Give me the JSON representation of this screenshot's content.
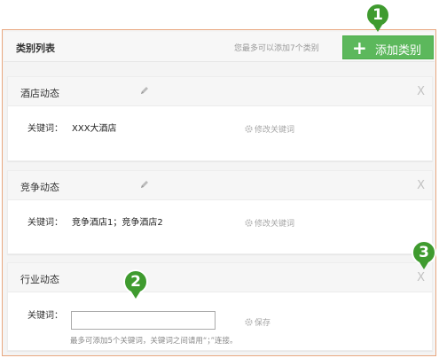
{
  "header": {
    "title": "类别列表",
    "limit_note": "您最多可以添加7个类别",
    "add_button_label": "添加类别",
    "add_button_plus": "+"
  },
  "categories": [
    {
      "name": "酒店动态",
      "keyword_label": "关键词：",
      "keywords": "XXX大酒店",
      "edit_label": "修改关键词",
      "close_label": "X"
    },
    {
      "name": "竞争动态",
      "keyword_label": "关键词：",
      "keywords": "竞争酒店1；竞争酒店2",
      "edit_label": "修改关键词",
      "close_label": "X"
    }
  ],
  "new_category": {
    "name": "行业动态",
    "keyword_label": "关键词：",
    "input_value": "",
    "save_label": "保存",
    "hint": "最多可添加5个关键词，关键词之间请用“；”连接。",
    "close_label": "X"
  },
  "markers": [
    "1",
    "2",
    "3"
  ],
  "colors": {
    "accent_green": "#5cb85c",
    "marker_green": "#3f9b2f",
    "frame_border": "#e8a77f"
  },
  "icons": {
    "edit": "pencil-icon",
    "gear": "gear-icon"
  }
}
